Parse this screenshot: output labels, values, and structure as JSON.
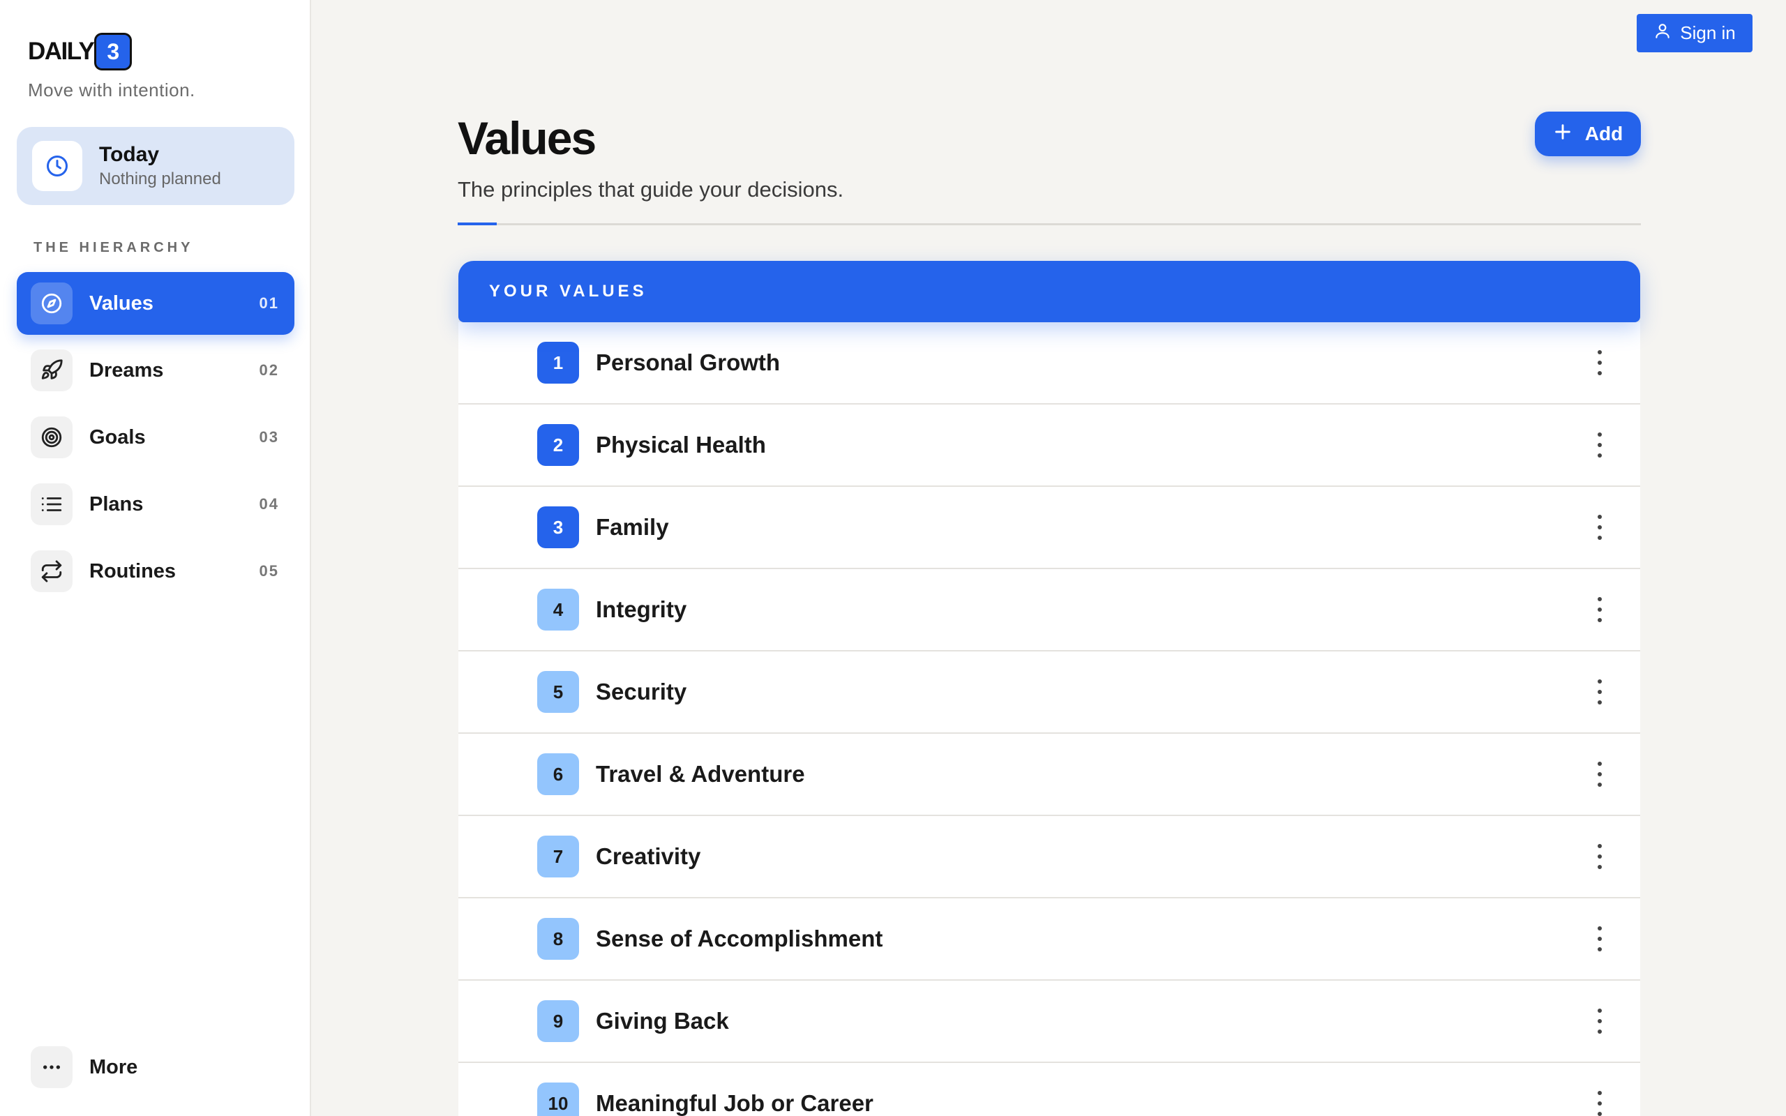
{
  "brand": {
    "word": "DAILY",
    "number": "3",
    "tagline": "Move with intention.",
    "accent": "#2563eb"
  },
  "today": {
    "title": "Today",
    "subtitle": "Nothing planned",
    "icon": "clock-icon"
  },
  "sidebar": {
    "section_label": "THE HIERARCHY",
    "items": [
      {
        "label": "Values",
        "num": "01",
        "icon": "compass-icon",
        "active": true
      },
      {
        "label": "Dreams",
        "num": "02",
        "icon": "rocket-icon",
        "active": false
      },
      {
        "label": "Goals",
        "num": "03",
        "icon": "target-icon",
        "active": false
      },
      {
        "label": "Plans",
        "num": "04",
        "icon": "list-icon",
        "active": false
      },
      {
        "label": "Routines",
        "num": "05",
        "icon": "repeat-icon",
        "active": false
      }
    ],
    "more_label": "More"
  },
  "header": {
    "signin_label": "Sign in"
  },
  "main": {
    "title": "Values",
    "subtitle": "The principles that guide your decisions.",
    "add_label": "Add",
    "list_header": "YOUR VALUES",
    "values": [
      {
        "rank": "1",
        "name": "Personal Growth",
        "tier": "dark"
      },
      {
        "rank": "2",
        "name": "Physical Health",
        "tier": "dark"
      },
      {
        "rank": "3",
        "name": "Family",
        "tier": "dark"
      },
      {
        "rank": "4",
        "name": "Integrity",
        "tier": "light"
      },
      {
        "rank": "5",
        "name": "Security",
        "tier": "light"
      },
      {
        "rank": "6",
        "name": "Travel & Adventure",
        "tier": "light"
      },
      {
        "rank": "7",
        "name": "Creativity",
        "tier": "light"
      },
      {
        "rank": "8",
        "name": "Sense of Accomplishment",
        "tier": "light"
      },
      {
        "rank": "9",
        "name": "Giving Back",
        "tier": "light"
      },
      {
        "rank": "10",
        "name": "Meaningful Job or Career",
        "tier": "light"
      }
    ]
  }
}
